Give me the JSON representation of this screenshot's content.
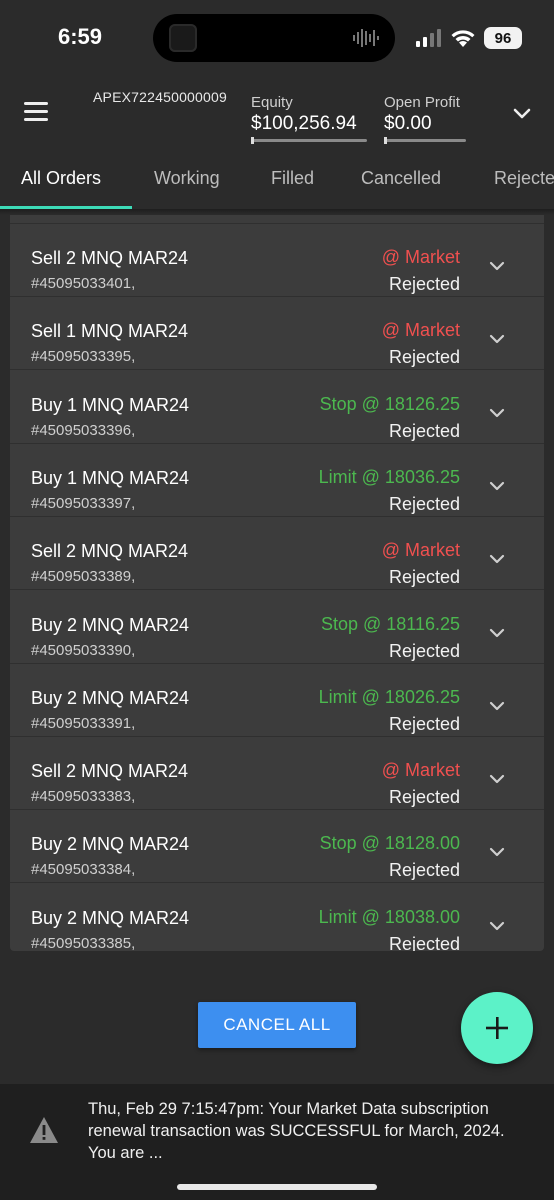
{
  "status_bar": {
    "time": "6:59",
    "battery": "96"
  },
  "header": {
    "account_id": "APEX722450000009",
    "equity_label": "Equity",
    "equity_value": "$100,256.94",
    "open_profit_label": "Open Profit",
    "open_profit_value": "$0.00"
  },
  "tabs": [
    {
      "label": "All Orders",
      "active": true
    },
    {
      "label": "Working",
      "active": false
    },
    {
      "label": "Filled",
      "active": false
    },
    {
      "label": "Cancelled",
      "active": false
    },
    {
      "label": "Rejected",
      "active": false
    }
  ],
  "orders": [
    {
      "title": "Sell 2 MNQ MAR24",
      "id": "#45095033401,",
      "price": "@ Market",
      "status": "Rejected",
      "kind": "market"
    },
    {
      "title": "Sell 1 MNQ MAR24",
      "id": "#45095033395,",
      "price": "@ Market",
      "status": "Rejected",
      "kind": "market"
    },
    {
      "title": "Buy 1 MNQ MAR24",
      "id": "#45095033396,",
      "price": "Stop @ 18126.25",
      "status": "Rejected",
      "kind": "limitstop"
    },
    {
      "title": "Buy 1 MNQ MAR24",
      "id": "#45095033397,",
      "price": "Limit @ 18036.25",
      "status": "Rejected",
      "kind": "limitstop"
    },
    {
      "title": "Sell 2 MNQ MAR24",
      "id": "#45095033389,",
      "price": "@ Market",
      "status": "Rejected",
      "kind": "market"
    },
    {
      "title": "Buy 2 MNQ MAR24",
      "id": "#45095033390,",
      "price": "Stop @ 18116.25",
      "status": "Rejected",
      "kind": "limitstop"
    },
    {
      "title": "Buy 2 MNQ MAR24",
      "id": "#45095033391,",
      "price": "Limit @ 18026.25",
      "status": "Rejected",
      "kind": "limitstop"
    },
    {
      "title": "Sell 2 MNQ MAR24",
      "id": "#45095033383,",
      "price": "@ Market",
      "status": "Rejected",
      "kind": "market"
    },
    {
      "title": "Buy 2 MNQ MAR24",
      "id": "#45095033384,",
      "price": "Stop @ 18128.00",
      "status": "Rejected",
      "kind": "limitstop"
    },
    {
      "title": "Buy 2 MNQ MAR24",
      "id": "#45095033385,",
      "price": "Limit @ 18038.00",
      "status": "Rejected",
      "kind": "limitstop"
    }
  ],
  "actions": {
    "cancel_all": "CANCEL ALL"
  },
  "notice": {
    "message": "Thu, Feb 29 7:15:47pm: Your Market Data subscription renewal transaction was SUCCESSFUL for March, 2024. You are ..."
  },
  "colors": {
    "market": "#f0504f",
    "limitstop": "#4cb84f",
    "accent": "#3ddbb8",
    "fab": "#5cf2c8",
    "button": "#3d8ff0"
  },
  "icons": {
    "menu": "hamburger-icon",
    "expand": "chevron-down-icon",
    "add": "plus-icon",
    "warning": "warning-icon"
  }
}
